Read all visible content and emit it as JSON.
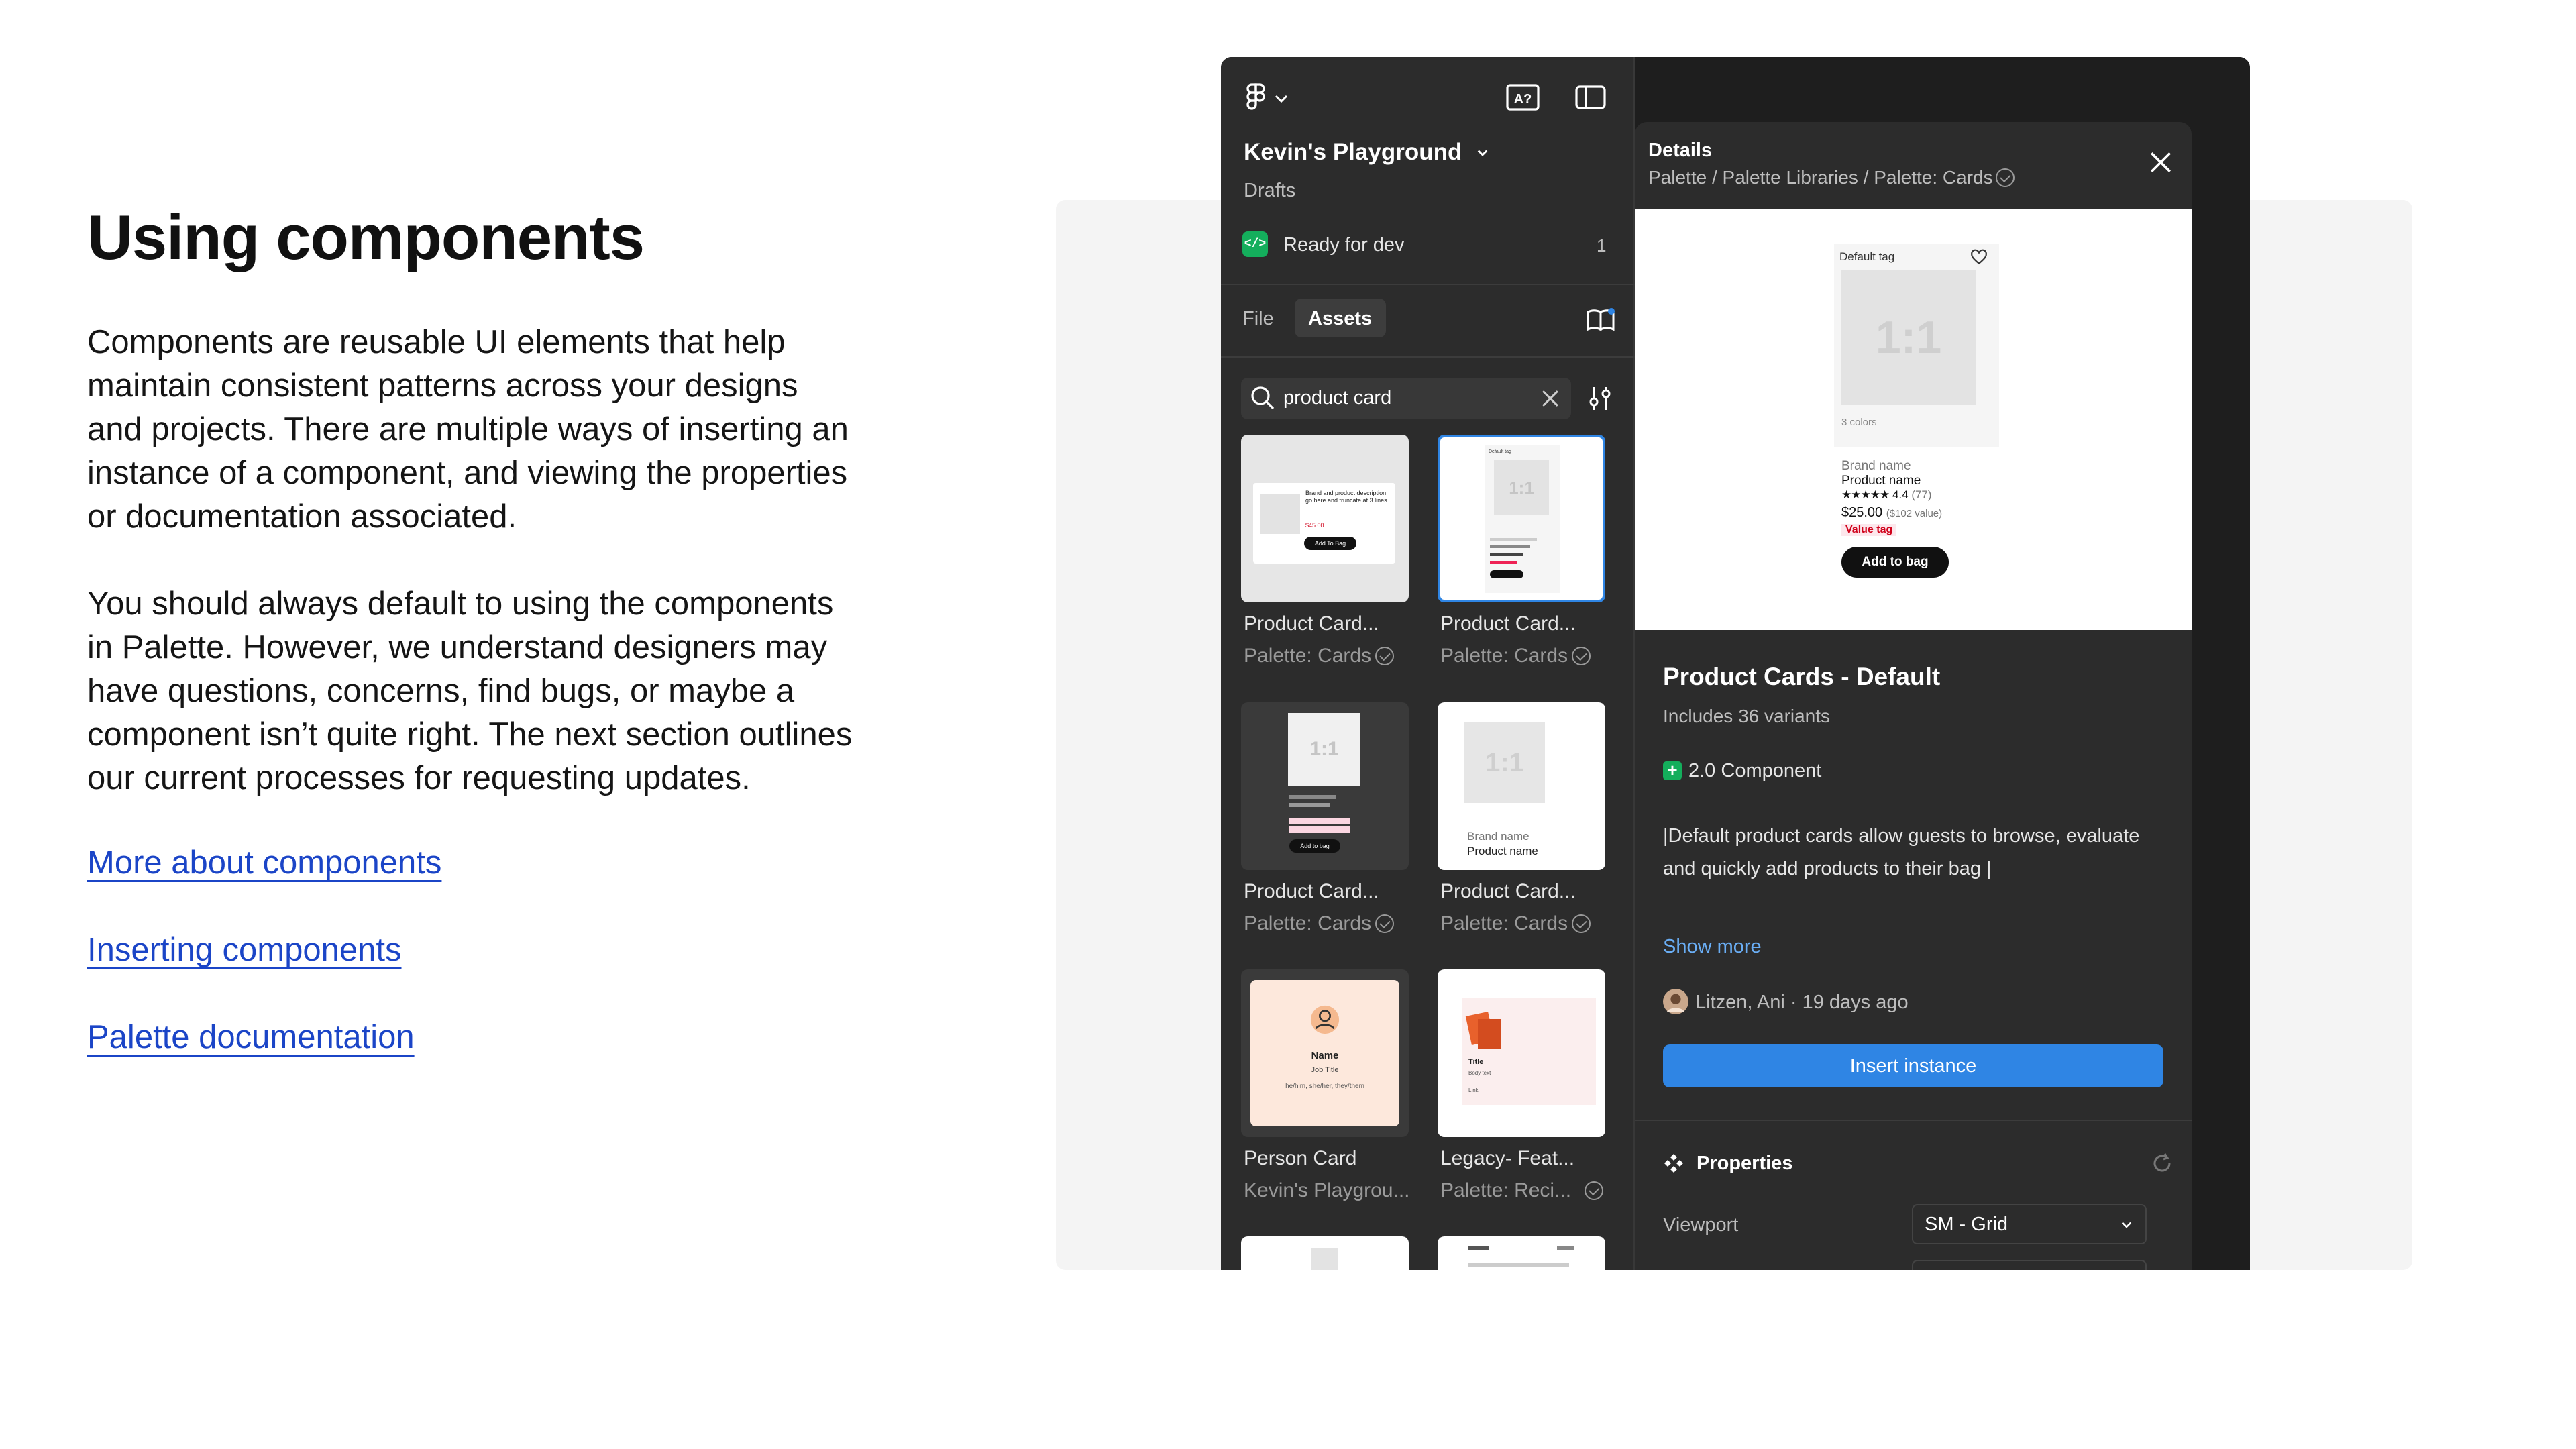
{
  "slide": {
    "title": "Using components",
    "paragraph1": "Components are reusable UI elements that help maintain consistent patterns across your designs and projects. There are multiple ways of inserting an instance of a component, and viewing the properties or documentation associated.",
    "paragraph2": "You should always default to using the components in Palette. However, we understand designers may have questions, concerns, find bugs, or maybe a component isn’t quite right. The next section outlines our current processes for requesting updates.",
    "links": [
      "More about components",
      "Inserting components",
      "Palette documentation"
    ]
  },
  "left_panel": {
    "project_name": "Kevin's Playground",
    "project_location": "Drafts",
    "ready_for_dev_label": "Ready for dev",
    "ready_for_dev_count": "1",
    "tabs": [
      "File",
      "Assets"
    ],
    "active_tab": "Assets",
    "search": {
      "value": "product card"
    },
    "assets": [
      {
        "name": "Product Card...",
        "library": "Palette: Cards"
      },
      {
        "name": "Product Card...",
        "library": "Palette: Cards"
      },
      {
        "name": "Product Card...",
        "library": "Palette: Cards"
      },
      {
        "name": "Product Card...",
        "library": "Palette: Cards"
      },
      {
        "name": "Person Card",
        "library": "Kevin's Playgrou..."
      },
      {
        "name": "Legacy- Feat...",
        "library": "Palette: Reci..."
      }
    ],
    "thumb_text": {
      "t1": "Brand and product description go here and truncate at 3 lines",
      "t1_price": "$45.00",
      "t1_button": "Add To Bag",
      "t2_tag": "Default tag",
      "t2_ratio": "1:1",
      "t3_ratio": "1:1",
      "t3_button": "Add to bag",
      "t4_ratio": "1:1",
      "t4_brand": "Brand name",
      "t4_product": "Product name",
      "t5_name": "Name",
      "t5_job": "Job Title",
      "t5_pronouns": "he/him, she/her, they/them",
      "t6_title": "Title",
      "t6_body": "Body text",
      "t6_link": "Link"
    }
  },
  "details": {
    "header": "Details",
    "breadcrumb": [
      "Palette",
      "Palette Libraries",
      "Palette: Cards"
    ],
    "preview": {
      "tag": "Default tag",
      "ratio": "1:1",
      "colors": "3 colors",
      "brand": "Brand name",
      "product": "Product name",
      "rating": "4.4",
      "reviews": "(77)",
      "price": "$25.00",
      "value": "($102 value)",
      "value_tag": "Value tag",
      "button": "Add to bag"
    },
    "component_name": "Product Cards - Default",
    "variants": "Includes 36 variants",
    "badge": "2.0 Component",
    "description": "|Default product cards allow guests to browse, evaluate and quickly add products to their bag |",
    "show_more": "Show more",
    "author": "Litzen, Ani",
    "updated": "19 days ago",
    "insert_button": "Insert instance",
    "properties_title": "Properties",
    "property_viewport_label": "Viewport",
    "property_viewport_value": "SM - Grid"
  },
  "colors": {
    "link": "#1b45c7",
    "panel": "#2c2c2c",
    "accent": "#2f85e4",
    "ready_green": "#14ae5c"
  }
}
